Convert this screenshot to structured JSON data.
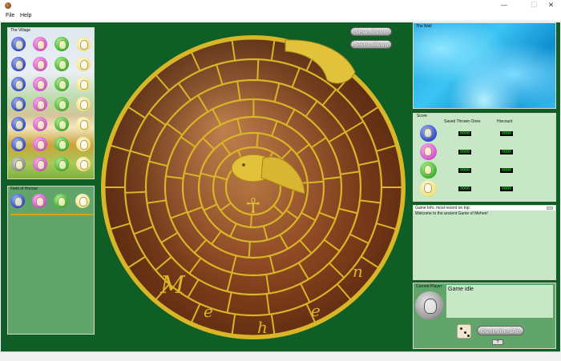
{
  "window": {
    "minimize_glyph": "—",
    "maximize_glyph": "☐",
    "close_glyph": "✕"
  },
  "menu": {
    "file": "File",
    "help": "Help"
  },
  "village": {
    "title": "The Village",
    "rows": [
      [
        "blue",
        "pink",
        "green",
        "yellow"
      ],
      [
        "blue",
        "pink",
        "green",
        "yellow"
      ],
      [
        "blue",
        "pink",
        "green",
        "yellow"
      ],
      [
        "blue",
        "pink",
        "green",
        "yellow"
      ],
      [
        "blue",
        "pink",
        "green",
        "yellow"
      ],
      [
        "blue",
        "pink",
        "green",
        "yellow"
      ],
      [
        "gray",
        "pink",
        "green",
        "yellow"
      ]
    ]
  },
  "honour": {
    "title": "Field of Honour",
    "tokens": [
      "blue",
      "pink",
      "green",
      "yellow"
    ]
  },
  "buttons": {
    "new_game": "New Game",
    "reset_game": "Reset Game"
  },
  "board": {
    "letters": [
      "M",
      "e",
      "h",
      "e",
      "n"
    ],
    "ankh": "☥"
  },
  "wall": {
    "title": "The Wall"
  },
  "score": {
    "title": "Score",
    "col_saved": "Saved Thrown Ones",
    "col_hiscore": "Hiscount",
    "rows": [
      {
        "token": "blue",
        "saved": "0000",
        "hiscore": "0000"
      },
      {
        "token": "pink",
        "saved": "0000",
        "hiscore": "0000"
      },
      {
        "token": "green",
        "saved": "0000",
        "hiscore": "0000"
      },
      {
        "token": "yellow",
        "saved": "0000",
        "hiscore": "0000"
      }
    ]
  },
  "info": {
    "caption": "Game Info, most recent on top:",
    "text": "Welcome to the ancient Game of Mehen!"
  },
  "player": {
    "label": "Current Player",
    "token": "gray",
    "status": "Game idle",
    "die_value": 3,
    "cast_button": "Cast the Die",
    "help_button": "?"
  },
  "colors": {
    "table_green": "#0f5e26",
    "panel_green": "#62a56b",
    "panel_light": "#c7e7c7",
    "gold": "#d8b627",
    "lcd_text": "#2cff2c"
  }
}
